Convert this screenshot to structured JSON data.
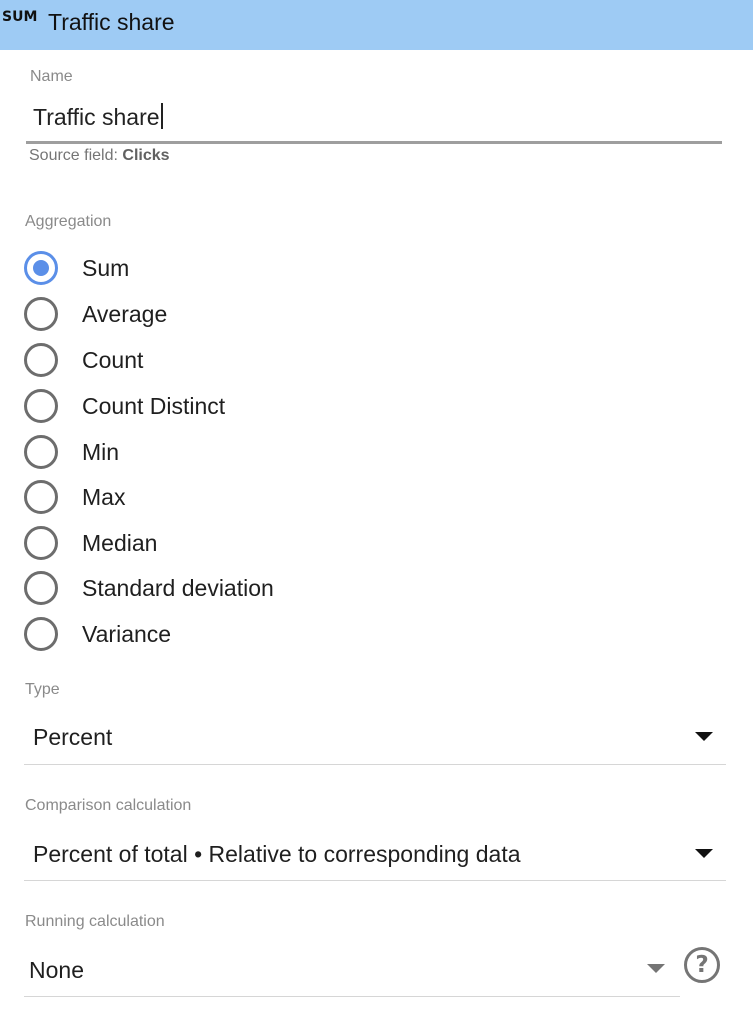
{
  "header": {
    "badge": "SUM",
    "title": "Traffic share"
  },
  "name_field": {
    "label": "Name",
    "value": "Traffic share"
  },
  "source": {
    "prefix": "Source field:",
    "field": "Clicks"
  },
  "aggregation": {
    "label": "Aggregation",
    "selected": "Sum",
    "options": [
      "Sum",
      "Average",
      "Count",
      "Count Distinct",
      "Min",
      "Max",
      "Median",
      "Standard deviation",
      "Variance"
    ]
  },
  "type": {
    "label": "Type",
    "value": "Percent"
  },
  "comparison": {
    "label": "Comparison calculation",
    "value": "Percent of total • Relative to corresponding data"
  },
  "running": {
    "label": "Running calculation",
    "value": "None",
    "help_icon": "?"
  },
  "colors": {
    "header_bg": "#9ecbf4",
    "accent": "#5b8fe8"
  },
  "icons": {
    "dropdown": "caret-down-icon",
    "help": "help-circle-icon"
  }
}
